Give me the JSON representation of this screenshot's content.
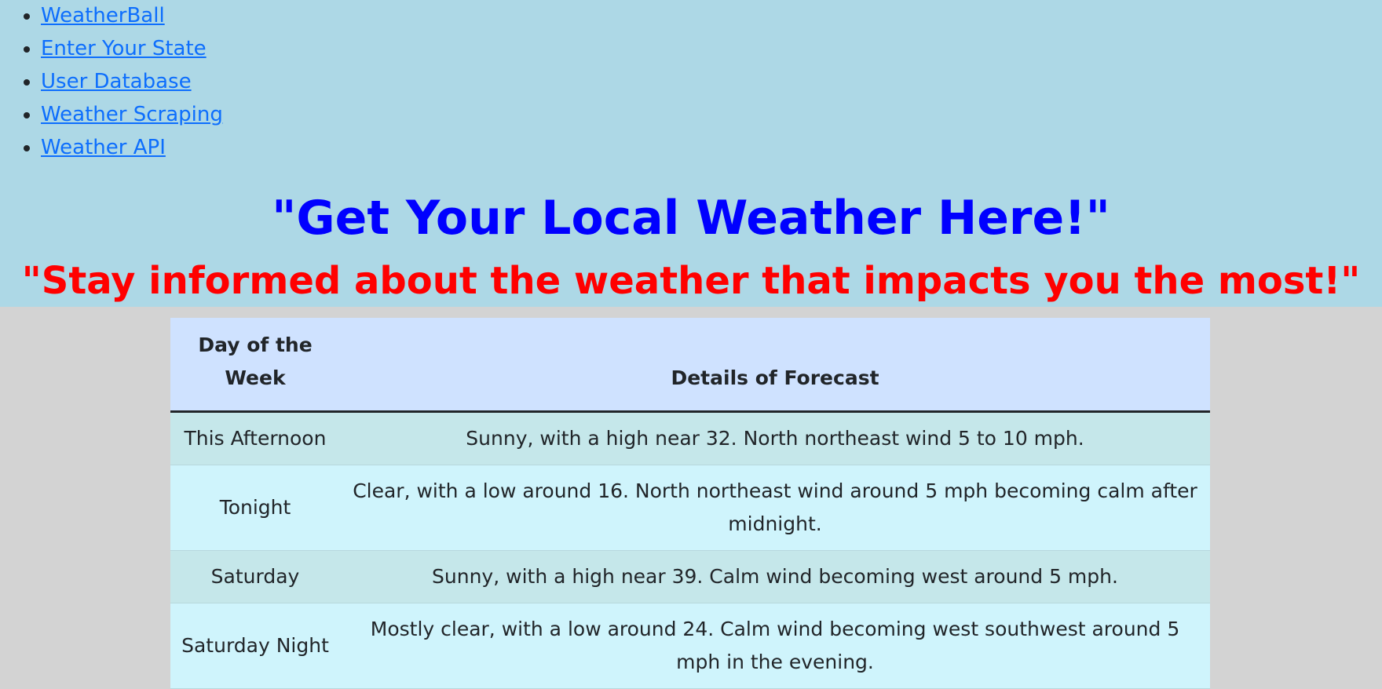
{
  "nav": {
    "links": [
      {
        "label": "WeatherBall"
      },
      {
        "label": "Enter Your State"
      },
      {
        "label": "User Database"
      },
      {
        "label": "Weather Scraping"
      },
      {
        "label": "Weather API"
      }
    ]
  },
  "hero": {
    "title": "\"Get Your Local Weather Here!\"",
    "subtitle": "\"Stay informed about the weather that impacts you the most!\""
  },
  "forecast_table": {
    "headers": {
      "day": "Day of the Week",
      "details": "Details of Forecast"
    },
    "rows": [
      {
        "day": "This Afternoon",
        "details": "Sunny, with a high near 32. North northeast wind 5 to 10 mph."
      },
      {
        "day": "Tonight",
        "details": "Clear, with a low around 16. North northeast wind around 5 mph becoming calm after midnight."
      },
      {
        "day": "Saturday",
        "details": "Sunny, with a high near 39. Calm wind becoming west around 5 mph."
      },
      {
        "day": "Saturday Night",
        "details": "Mostly clear, with a low around 24. Calm wind becoming west southwest around 5 mph in the evening."
      }
    ]
  },
  "colors": {
    "header_bg": "#add8e6",
    "page_bg": "#d3d3d3",
    "title": "#0000ff",
    "subtitle": "#ff0000",
    "link": "#0d6efd",
    "table_head_bg": "#cfe2ff"
  }
}
